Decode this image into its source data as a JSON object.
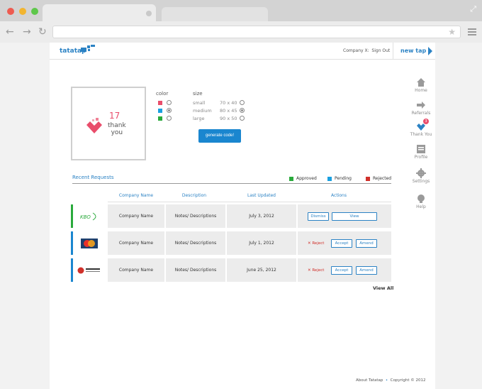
{
  "header": {
    "logo": "tatatap",
    "account": "Company X",
    "sign_out": "Sign Out",
    "new_tap": "new tap"
  },
  "preview": {
    "number": "17",
    "line1": "thank",
    "line2": "you"
  },
  "options": {
    "color_label": "color",
    "size_label": "size",
    "colors": [
      "#e94d6b",
      "#1aa0e0",
      "#2aaa3c"
    ],
    "selected_color_index": 1,
    "sizes": [
      {
        "label": "small",
        "dims": "70 x 40"
      },
      {
        "label": "medium",
        "dims": "80 x 45"
      },
      {
        "label": "large",
        "dims": "90 x 50"
      }
    ],
    "selected_size_index": 1,
    "generate_label": "generate code!"
  },
  "requests": {
    "title": "Recent Requests",
    "legend": [
      {
        "label": "Approved",
        "color": "#2aaa3c"
      },
      {
        "label": "Pending",
        "color": "#1aa0e0"
      },
      {
        "label": "Rejected",
        "color": "#d0302a"
      }
    ],
    "columns": [
      "Company Name",
      "Description",
      "Last Updated",
      "Actions"
    ],
    "rows": [
      {
        "company": "Company Name",
        "desc": "Notes/ Descriptions",
        "date": "July 3, 2012",
        "status_color": "#2aaa3c",
        "logo": "kbo-logo",
        "actions": [
          "Dismiss",
          "View"
        ]
      },
      {
        "company": "Company Name",
        "desc": "Notes/ Descriptions",
        "date": "July 1, 2012",
        "status_color": "#1a86cf",
        "logo": "mastercard-logo",
        "reject": "Reject",
        "actions": [
          "Accept",
          "Amend"
        ]
      },
      {
        "company": "Company Name",
        "desc": "Notes/ Descriptions",
        "date": "June 25, 2012",
        "status_color": "#1a86cf",
        "logo": "bank-logo",
        "reject": "Reject",
        "actions": [
          "Accept",
          "Amend"
        ]
      }
    ],
    "view_all": "View All"
  },
  "sidebar": {
    "items": [
      {
        "label": "Home",
        "icon": "home-icon"
      },
      {
        "label": "Referrals",
        "icon": "arrow-icon"
      },
      {
        "label": "Thank You",
        "icon": "heart-icon",
        "badge": "3"
      },
      {
        "label": "Profile",
        "icon": "profile-icon"
      },
      {
        "label": "Settings",
        "icon": "gear-icon"
      },
      {
        "label": "Help",
        "icon": "bulb-icon"
      }
    ]
  },
  "footer": {
    "about": "About Tatatap",
    "copyright": "Copyright © 2012"
  }
}
